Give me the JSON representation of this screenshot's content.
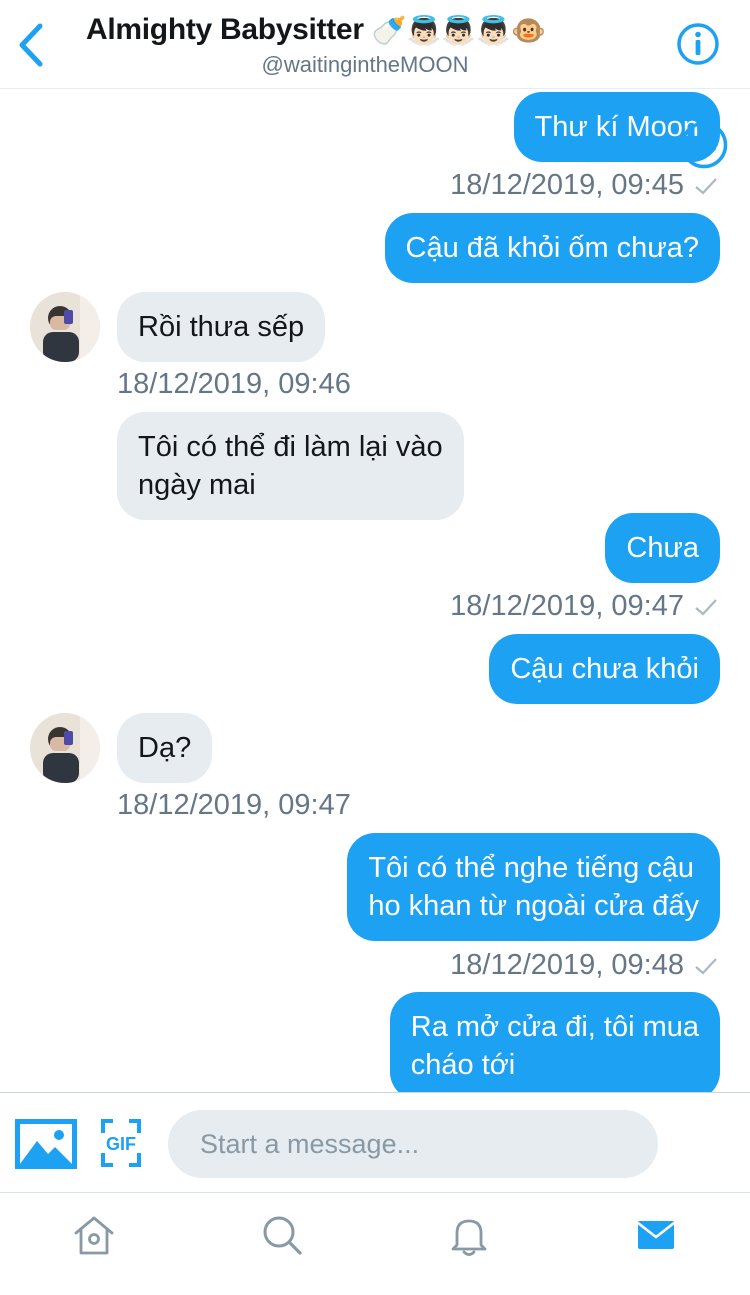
{
  "header": {
    "title": "Almighty Babysitter",
    "title_emoji": "🍼👼🏻👼🏻👼🏻🐵",
    "handle": "@waitingintheMOON",
    "back_icon": "chevron-left-icon",
    "info_icon": "info-icon"
  },
  "colors": {
    "accent": "#1da1f2",
    "incoming_bubble": "#e6ecf0",
    "meta_text": "#657786"
  },
  "messages": [
    {
      "dir": "out",
      "text": "Thư kí Moon"
    },
    {
      "dir": "meta",
      "text": "18/12/2019, 09:45"
    },
    {
      "dir": "out",
      "text": "Cậu đã khỏi ốm chưa?"
    },
    {
      "dir": "in",
      "text": "Rồi thưa sếp"
    },
    {
      "dir": "meta",
      "text": "18/12/2019, 09:46"
    },
    {
      "dir": "in",
      "lines": [
        "Tôi có thể đi làm lại vào",
        "ngày mai"
      ]
    },
    {
      "dir": "out",
      "text": "Chưa"
    },
    {
      "dir": "meta",
      "text": "18/12/2019, 09:47"
    },
    {
      "dir": "out",
      "text": "Cậu chưa khỏi"
    },
    {
      "dir": "in",
      "text": "Dạ?"
    },
    {
      "dir": "meta",
      "text": "18/12/2019, 09:47"
    },
    {
      "dir": "out",
      "lines": [
        "Tôi có thể nghe tiếng cậu",
        "ho khan từ ngoài cửa đấy"
      ]
    },
    {
      "dir": "meta",
      "text": "18/12/2019, 09:48"
    },
    {
      "dir": "out",
      "lines": [
        "Ra mở cửa đi, tôi mua",
        "cháo tới"
      ]
    }
  ],
  "composer": {
    "placeholder": "Start a message...",
    "image_icon": "image-icon",
    "gif_label": "GIF",
    "emoji_icon": "emoji-icon"
  },
  "tabs": [
    {
      "name": "home",
      "icon": "home-icon",
      "active": false
    },
    {
      "name": "search",
      "icon": "search-icon",
      "active": false
    },
    {
      "name": "notifications",
      "icon": "bell-icon",
      "active": false
    },
    {
      "name": "messages",
      "icon": "mail-icon",
      "active": true
    }
  ]
}
